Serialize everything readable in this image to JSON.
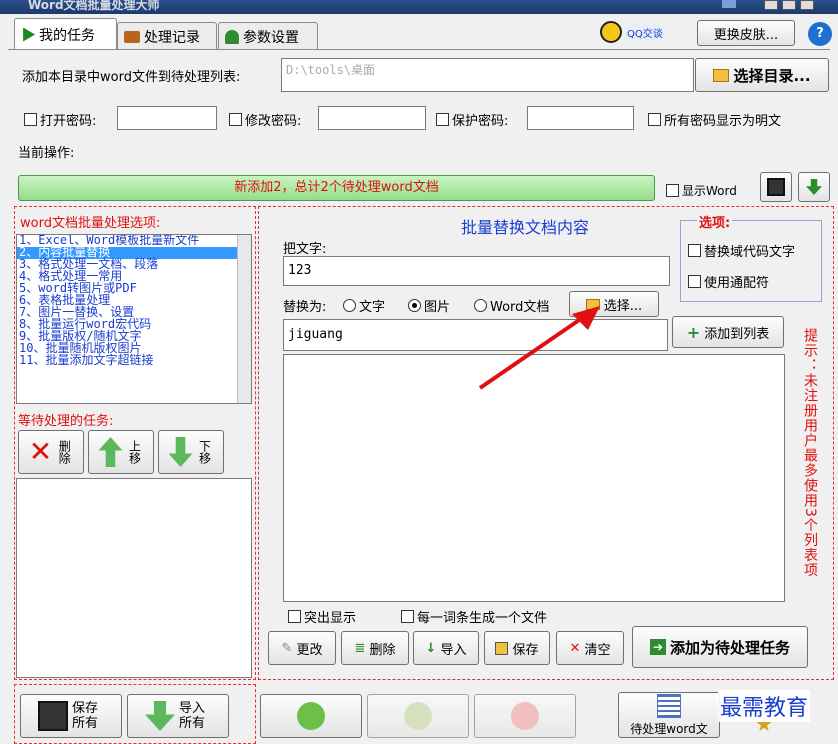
{
  "titlebar": {
    "title": "Word文档批量处理大师"
  },
  "tabs": [
    {
      "label": "我的任务"
    },
    {
      "label": "处理记录"
    },
    {
      "label": "参数设置"
    }
  ],
  "header": {
    "qq_label": "QQ交谈",
    "skin_button": "更换皮肤..."
  },
  "dir_row": {
    "label": "添加本目录中word文件到待处理列表:",
    "path": "D:\\tools\\桌面",
    "select_button": "选择目录..."
  },
  "passwords": {
    "open": "打开密码:",
    "modify": "修改密码:",
    "protect": "保护密码:",
    "show_plain": "所有密码显示为明文"
  },
  "current_op": {
    "label": "当前操作:"
  },
  "status": {
    "text": "新添加2，总计2个待处理word文档",
    "show_word": "显示Word"
  },
  "options_list": {
    "title": "word文档批量处理选项:",
    "items": [
      "1、Excel、Word模板批量新文件",
      "2、内容批量替换",
      "3、格式处理一文档、段落",
      "4、格式处理一常用",
      "5、word转图片或PDF",
      "6、表格批量处理",
      "7、图片一替换、设置",
      "8、批量运行word宏代码",
      "9、批量版权/随机文字",
      "10、批量随机版权图片",
      "11、批量添加文字超链接"
    ]
  },
  "pending": {
    "title": "等待处理的任务:",
    "delete": "删除",
    "up": "上移",
    "down": "下移"
  },
  "panel": {
    "title": "批量替换文档内容",
    "find_label": "把文字:",
    "find_value": "123",
    "replace_label": "替换为:",
    "radio_text": "文字",
    "radio_image": "图片",
    "radio_word": "Word文档",
    "select_button": "选择...",
    "replace_value": "jiguang",
    "add_to_list": "添加到列表",
    "highlight": "突出显示",
    "per_term_file": "每一词条生成一个文件",
    "btn_edit": "更改",
    "btn_delete": "删除",
    "btn_import": "导入",
    "btn_save": "保存",
    "btn_clear": "清空",
    "btn_add_task": "添加为待处理任务"
  },
  "options_box": {
    "title": "选项:",
    "field_code": "替换域代码文字",
    "wildcard": "使用通配符"
  },
  "hint": {
    "text": "提示：未注册用户最多使用3个列表项"
  },
  "bottom": {
    "save_all": "保存所有",
    "import_all": "导入所有",
    "pending_word": "待处理word文",
    "watermark": "最需教育"
  },
  "colors": {
    "accent_red": "#e01010",
    "accent_blue": "#1a3cd0",
    "status_green": "#a8e6a0",
    "selection": "#3399ff"
  }
}
